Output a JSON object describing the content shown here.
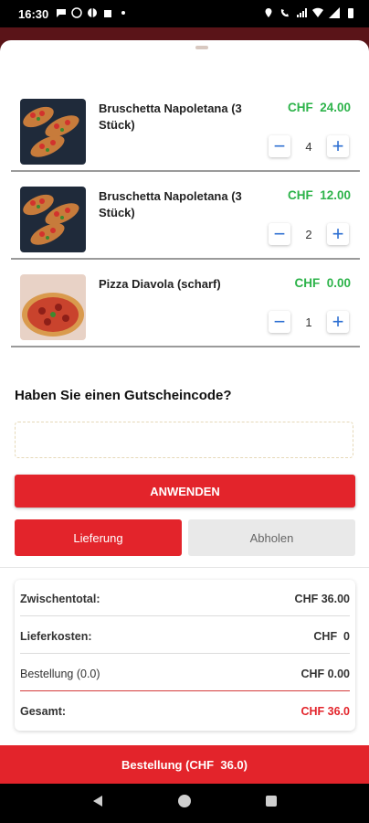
{
  "status_bar": {
    "time": "16:30"
  },
  "cart": {
    "items": [
      {
        "name": "Bruschetta Napoletana (3 Stück)",
        "price": "CHF  24.00",
        "qty": "4"
      },
      {
        "name": "Bruschetta Napoletana (3 Stück)",
        "price": "CHF  12.00",
        "qty": "2"
      },
      {
        "name": "Pizza Diavola (scharf)",
        "price": "CHF  0.00",
        "qty": "1"
      }
    ]
  },
  "coupon": {
    "title": "Haben Sie einen Gutscheincode?",
    "placeholder": "",
    "apply_label": "ANWENDEN"
  },
  "delivery_tabs": {
    "delivery": "Lieferung",
    "pickup": "Abholen",
    "selected": "delivery"
  },
  "summary": {
    "subtotal_label": "Zwischentotal:",
    "subtotal_value": "CHF 36.00",
    "delivery_label": "Lieferkosten:",
    "delivery_value": "CHF  0",
    "order_label": "Bestellung (0.0)",
    "order_value": "CHF 0.00",
    "total_label": "Gesamt:",
    "total_value": "CHF 36.0"
  },
  "order_button": {
    "label": "Bestellung (CHF  36.0)"
  },
  "colors": {
    "accent": "#e3242b",
    "price_green": "#2db34a",
    "stepper_blue": "#2d6fd2"
  }
}
